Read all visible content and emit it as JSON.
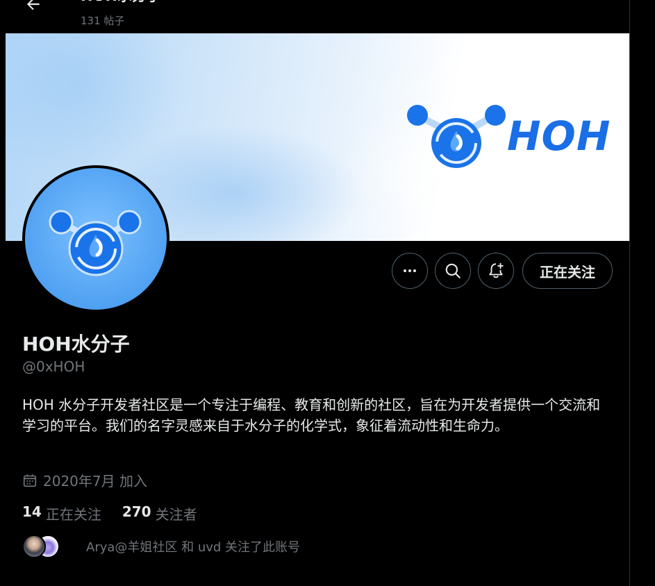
{
  "header": {
    "title": "HOH水分子",
    "post_count": "131 帖子"
  },
  "banner": {
    "wordmark": "HOH"
  },
  "profile": {
    "display_name": "HOH水分子",
    "handle": "@0xHOH",
    "bio": "HOH 水分子开发者社区是一个专注于编程、教育和创新的社区，旨在为开发者提供一个交流和学习的平台。我们的名字灵感来自于水分子的化学式，象征着流动性和生命力。",
    "joined": "2020年7月 加入"
  },
  "actions": {
    "more_icon": "more-icon",
    "search_icon": "search-icon",
    "notify_icon": "notification-bell-icon",
    "follow_label": "正在关注"
  },
  "stats": {
    "following_count": "14",
    "following_label": "正在关注",
    "followers_count": "270",
    "followers_label": "关注者"
  },
  "mutuals": {
    "text": "Arya@羊姐社区 和 uvd 关注了此账号"
  },
  "colors": {
    "background": "#000000",
    "text_primary": "#e7e9ea",
    "text_secondary": "#71767b",
    "border": "#536471",
    "brand_blue": "#1a6ee6"
  }
}
